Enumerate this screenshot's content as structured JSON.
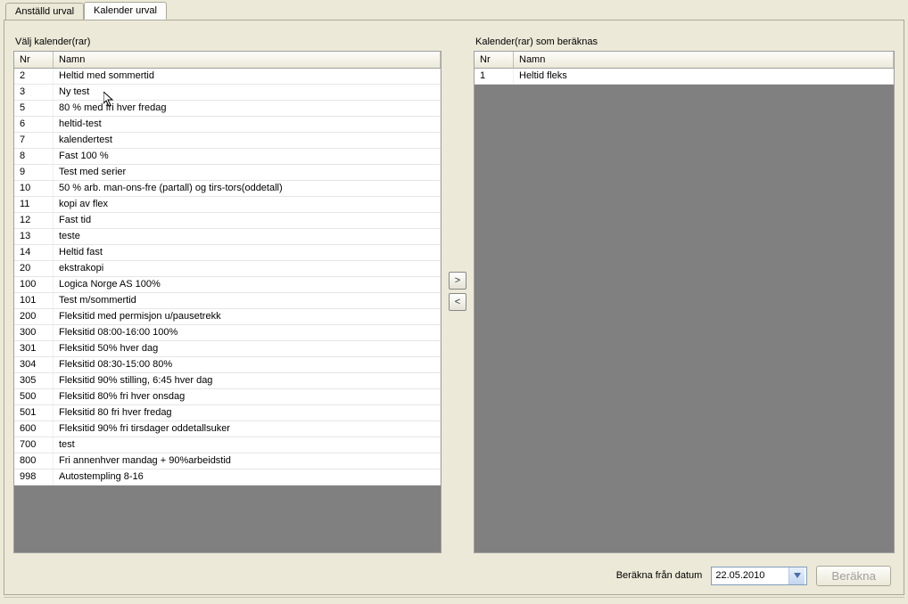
{
  "tabs": {
    "employee": "Anställd urval",
    "calendar": "Kalender urval"
  },
  "left": {
    "label": "Välj kalender(rar)",
    "columns": {
      "nr": "Nr",
      "name": "Namn"
    },
    "rows": [
      {
        "nr": "2",
        "name": "Heltid med sommertid"
      },
      {
        "nr": "3",
        "name": "Ny test"
      },
      {
        "nr": "5",
        "name": "80 % med fri hver fredag"
      },
      {
        "nr": "6",
        "name": "heltid-test"
      },
      {
        "nr": "7",
        "name": "kalendertest"
      },
      {
        "nr": "8",
        "name": "Fast 100 %"
      },
      {
        "nr": "9",
        "name": "Test med serier"
      },
      {
        "nr": "10",
        "name": "50 %  arb. man-ons-fre (partall)  og tirs-tors(oddetall)"
      },
      {
        "nr": "11",
        "name": "kopi av flex"
      },
      {
        "nr": "12",
        "name": "Fast tid"
      },
      {
        "nr": "13",
        "name": "teste"
      },
      {
        "nr": "14",
        "name": "Heltid fast"
      },
      {
        "nr": "20",
        "name": "ekstrakopi"
      },
      {
        "nr": "100",
        "name": "Logica Norge AS 100%"
      },
      {
        "nr": "101",
        "name": "Test m/sommertid"
      },
      {
        "nr": "200",
        "name": "Fleksitid med permisjon u/pausetrekk"
      },
      {
        "nr": "300",
        "name": "Fleksitid 08:00-16:00 100%"
      },
      {
        "nr": "301",
        "name": "Fleksitid 50% hver dag"
      },
      {
        "nr": "304",
        "name": "Fleksitid 08:30-15:00 80%"
      },
      {
        "nr": "305",
        "name": "Fleksitid 90% stilling, 6:45 hver dag"
      },
      {
        "nr": "500",
        "name": "Fleksitid 80% fri hver onsdag"
      },
      {
        "nr": "501",
        "name": "Fleksitid 80  fri hver fredag"
      },
      {
        "nr": "600",
        "name": "Fleksitid  90% fri tirsdager oddetallsuker"
      },
      {
        "nr": "700",
        "name": "test"
      },
      {
        "nr": "800",
        "name": "Fri annenhver mandag + 90%arbeidstid"
      },
      {
        "nr": "998",
        "name": "Autostempling 8-16"
      }
    ]
  },
  "right": {
    "label": "Kalender(rar) som beräknas",
    "columns": {
      "nr": "Nr",
      "name": "Namn"
    },
    "rows": [
      {
        "nr": "1",
        "name": "Heltid fleks"
      }
    ]
  },
  "buttons": {
    "move_right": ">",
    "move_left": "<"
  },
  "footer": {
    "date_label": "Beräkna från datum",
    "date_value": "22.05.2010",
    "calc_button": "Beräkna"
  }
}
